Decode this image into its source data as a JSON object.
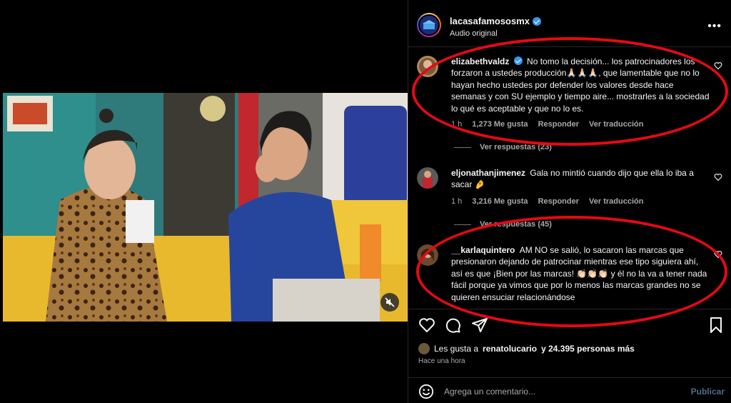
{
  "post": {
    "username": "lacasafamososmx",
    "subtitle": "Audio original",
    "more_label": "•••"
  },
  "comments": [
    {
      "username": "elizabethvaldz",
      "text": "No tomo la decisión... los patrocinadores los forzaron a ustedes producción🙏🏻🙏🏻🙏🏻, que lamentable que no lo hayan hecho ustedes por defender los valores desde hace semanas y con SU ejemplo y tiempo aire... mostrarles a la sociedad lo qué es aceptable y que no lo es.",
      "time": "1 h",
      "likes": "1,273 Me gusta",
      "reply": "Responder",
      "translate": "Ver traducción",
      "replies": "Ver respuestas (23)"
    },
    {
      "username": "eljonathanjimenez",
      "text": "Gala no mintió cuando dijo que ella lo iba a sacar 🤌",
      "time": "1 h",
      "likes": "3,216 Me gusta",
      "reply": "Responder",
      "translate": "Ver traducción",
      "replies": "Ver respuestas (45)"
    },
    {
      "username": "__karlaquintero",
      "text": "AM NO se salió, lo sacaron las marcas que presionaron dejando de patrocinar mientras ese tipo siguiera ahí, así es que ¡Bien por las marcas! 👏🏻👏🏻👏🏻 y él no la va a tener nada fácil porque ya vimos que por lo menos las marcas grandes no se quieren ensuciar relacionándose"
    }
  ],
  "likes_summary": {
    "prefix": "Les gusta a",
    "user": "renatolucario",
    "suffix": "y 24.395 personas más"
  },
  "time_ago": "Hace una hora",
  "add_comment": {
    "placeholder": "Agrega un comentario...",
    "publish": "Publicar"
  },
  "colors": {
    "annotation": "#e50914",
    "verified": "#3897f0"
  }
}
